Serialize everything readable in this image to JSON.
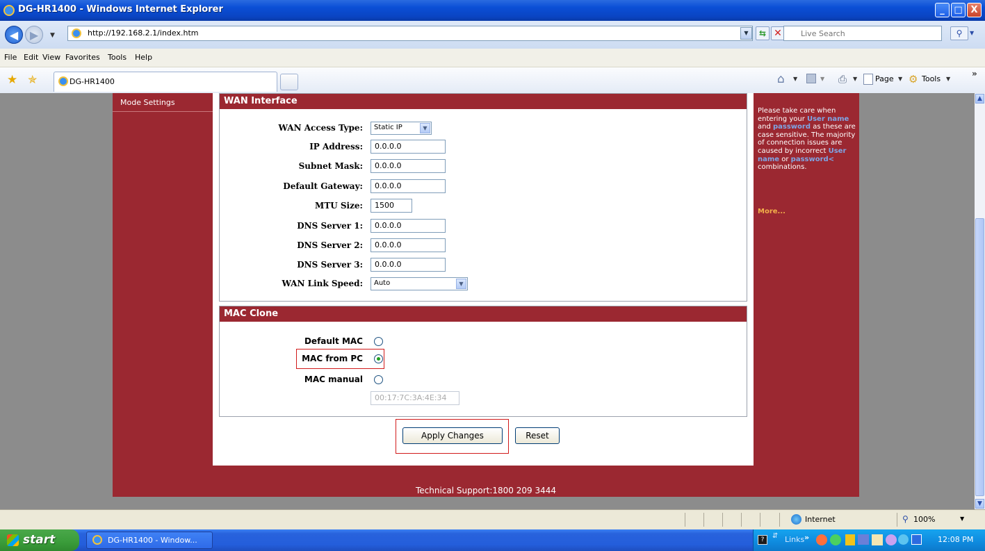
{
  "window": {
    "title": "DG-HR1400 - Windows Internet Explorer",
    "buttons": [
      "_",
      "□",
      "X"
    ]
  },
  "address": {
    "url": "http://192.168.2.1/index.htm",
    "search_placeholder": "Live Search"
  },
  "menubar": [
    "File",
    "Edit",
    "View",
    "Favorites",
    "Tools",
    "Help"
  ],
  "tab": {
    "title": "DG-HR1400"
  },
  "toolbar": {
    "page_label": "Page",
    "tools_label": "Tools"
  },
  "sidebar": {
    "item": "Mode Settings"
  },
  "wan": {
    "header": "WAN Interface",
    "fields": [
      {
        "label": "WAN Access Type:",
        "value": "Static IP",
        "type": "select"
      },
      {
        "label": "IP Address:",
        "value": "0.0.0.0",
        "type": "text"
      },
      {
        "label": "Subnet Mask:",
        "value": "0.0.0.0",
        "type": "text"
      },
      {
        "label": "Default Gateway:",
        "value": "0.0.0.0",
        "type": "text"
      },
      {
        "label": "MTU Size:",
        "value": "1500",
        "type": "text"
      },
      {
        "label": "DNS Server 1:",
        "value": "0.0.0.0",
        "type": "text"
      },
      {
        "label": "DNS Server 2:",
        "value": "0.0.0.0",
        "type": "text"
      },
      {
        "label": "DNS Server 3:",
        "value": "0.0.0.0",
        "type": "text"
      },
      {
        "label": "WAN Link Speed:",
        "value": "Auto",
        "type": "select"
      }
    ]
  },
  "mac": {
    "header": "MAC Clone",
    "options": [
      {
        "label": "Default MAC",
        "selected": false
      },
      {
        "label": "MAC from PC",
        "selected": true
      },
      {
        "label": "MAC manual",
        "selected": false
      }
    ],
    "manual_value": "00:17:7C:3A:4E:34"
  },
  "buttons": {
    "apply": "Apply Changes",
    "reset": "Reset"
  },
  "help": {
    "t1": "Please take care when entering your ",
    "e1": "User name",
    "t2": " and ",
    "e2": "password",
    "t3": " as these are case sensitive. The majority of connection issues are caused by incorrect ",
    "e3": "User name",
    "t4": " or ",
    "e4": "password<",
    "t5": " combinations.",
    "more": "More..."
  },
  "footer": {
    "support": "Technical Support:1800 209 3444"
  },
  "statusbar": {
    "zone": "Internet",
    "zoom": "100%"
  },
  "taskbar": {
    "start": "start",
    "task": "DG-HR1400 - Window...",
    "links": "Links",
    "time": "12:08 PM"
  },
  "colors": {
    "panel_red": "#9b2831",
    "highlight": "#d11a1a",
    "link_blue": "#7ea6e6",
    "more_orange": "#f2b04a"
  }
}
